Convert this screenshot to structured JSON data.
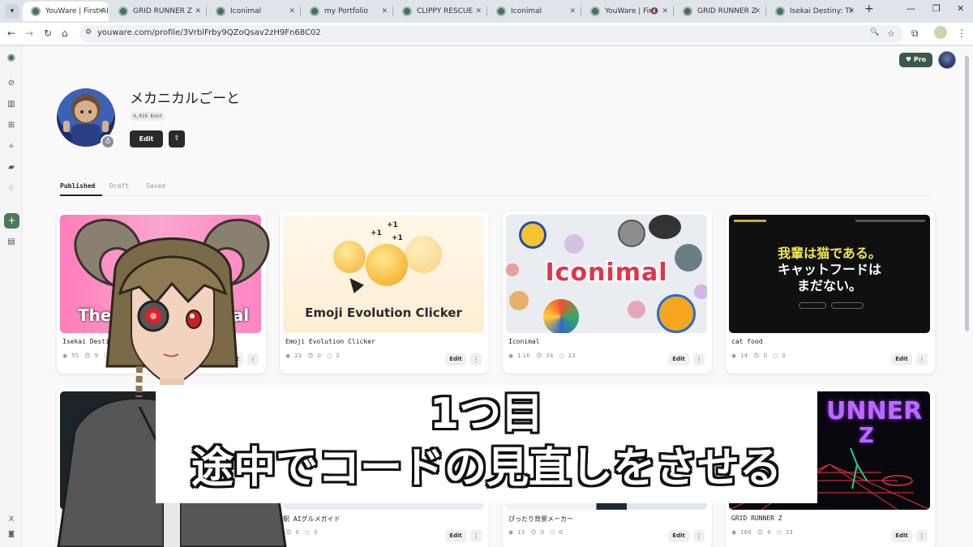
{
  "browser": {
    "tabs": [
      {
        "title": "YouWare | First AI Co",
        "active": true
      },
      {
        "title": "GRID RUNNER Z"
      },
      {
        "title": "Iconimal"
      },
      {
        "title": "my Portfolio"
      },
      {
        "title": "CLIPPY RESCUE"
      },
      {
        "title": "Iconimal"
      },
      {
        "title": "YouWare | First AI"
      },
      {
        "title": "GRID RUNNER Z"
      },
      {
        "title": "Isekai Destiny: The G"
      }
    ],
    "url": "youware.com/profile/3VrblFrby9QZoQsav2zH9Fn68C02",
    "icons": {
      "back": "←",
      "forward": "→",
      "reload": "↻",
      "home": "⌂",
      "site_info": "⚙",
      "zoom": "🔍",
      "bookmark": "☆",
      "extensions": "⧉",
      "menu": "⋮",
      "minimize": "—",
      "restore": "❐",
      "close": "✕",
      "new_tab": "+"
    }
  },
  "header": {
    "pro_label": "Pro",
    "pro_icon": "♥"
  },
  "profile": {
    "name": "メカニカルごーと",
    "knot_badge": "4,016 Knot",
    "edit_label": "Edit",
    "share_icon": "⇪"
  },
  "profile_tabs": [
    "Published",
    "Draft",
    "Saved"
  ],
  "cards": [
    {
      "title": "Isekai Destiny: The Go",
      "thumb_text": "The",
      "thumb_text_2": "rial",
      "views": "55",
      "likes": "9",
      "comments": "0",
      "edit_label": "Edit",
      "more": "⋮"
    },
    {
      "title": "Emoji Evolution Clicker",
      "thumb_text": "Emoji Evolution Clicker",
      "plus": "+1",
      "views": "23",
      "likes": "0",
      "comments": "2",
      "edit_label": "Edit",
      "more": "⋮"
    },
    {
      "title": "Iconimal",
      "thumb_text": "Iconimal",
      "views": "1.1K",
      "likes": "24",
      "comments": "23",
      "edit_label": "Edit",
      "more": "⋮"
    },
    {
      "title": "cat food",
      "thumb_text_1": "我輩は猫である。",
      "thumb_text_2": "キャットフードは",
      "thumb_text_3": "まだない。",
      "views": "14",
      "likes": "0",
      "comments": "0",
      "edit_label": "Edit",
      "more": "⋮"
    },
    {
      "title": "京駅 AIグルメガイド",
      "views": "",
      "likes": "0",
      "comments": "0",
      "edit_label": "Edit",
      "more": "⋮"
    },
    {
      "title": "ぴったり背景メーカー",
      "views": "13",
      "likes": "0",
      "comments": "0",
      "edit_label": "Edit",
      "more": "⋮"
    },
    {
      "title": "GRID RUNNER Z",
      "thumb_text": "UNNER",
      "thumb_text_2": "Z",
      "views": "169",
      "likes": "4",
      "comments": "13",
      "edit_label": "Edit",
      "more": "⋮"
    }
  ],
  "stat_icons": {
    "views": "◉",
    "likes": "😊",
    "comments": "○"
  },
  "sidebar_icons": [
    "spark",
    "compass",
    "book",
    "gift",
    "puzzle",
    "folder",
    "bell",
    "plus",
    "doc",
    "x",
    "discord"
  ],
  "sidebar_glyphs": {
    "logo": "✺",
    "compass": "⊘",
    "book": "▥",
    "gift": "⊞",
    "puzzle": "⟡",
    "folder": "▰",
    "bell": "♢",
    "plus": "+",
    "doc": "▤",
    "x": "X",
    "discord": "◙"
  },
  "caption": {
    "line1": "1つ目",
    "line2": "途中でコードの見直しをさせる"
  },
  "colors": {
    "accent": "#4a7a5a",
    "pro_bg": "#3c5a47",
    "iconimal_title": "#e0344d",
    "cat_yellow": "#f3e84a",
    "grid_purple": "#b96bff"
  }
}
